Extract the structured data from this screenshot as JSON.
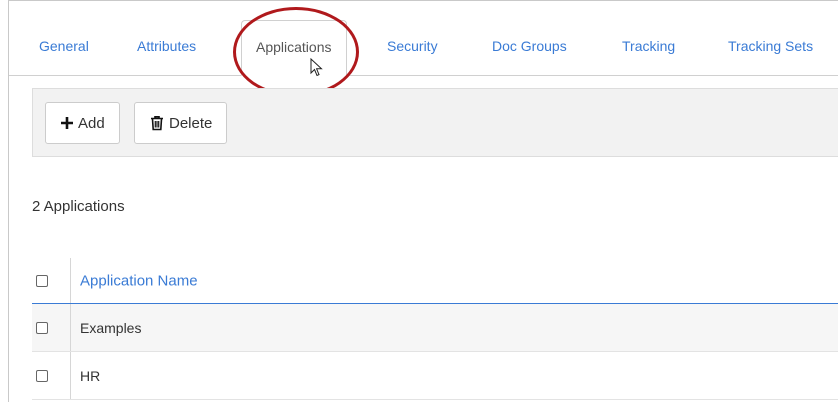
{
  "tabs": [
    {
      "label": "General"
    },
    {
      "label": "Attributes"
    },
    {
      "label": "Applications"
    },
    {
      "label": "Security"
    },
    {
      "label": "Doc Groups"
    },
    {
      "label": "Tracking"
    },
    {
      "label": "Tracking Sets"
    }
  ],
  "active_tab": "Applications",
  "toolbar": {
    "add_label": "Add",
    "delete_label": "Delete",
    "add_icon": "plus-icon",
    "delete_icon": "trash-icon"
  },
  "summary": {
    "count_text": "2 Applications"
  },
  "table": {
    "columns": [
      "Application Name"
    ],
    "rows": [
      {
        "name": "Examples"
      },
      {
        "name": "HR"
      }
    ]
  },
  "colors": {
    "link": "#3a7bd5",
    "highlight": "#b0191c",
    "toolbar_bg": "#f2f2f2"
  }
}
